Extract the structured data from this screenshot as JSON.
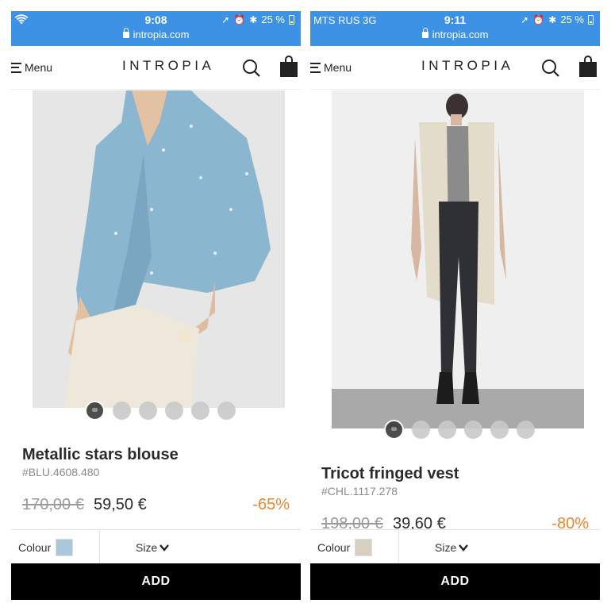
{
  "screens": [
    {
      "status": {
        "carrier": "",
        "time": "9:08",
        "url": "intropia.com",
        "battery": "25 %"
      },
      "header": {
        "menu_label": "Menu",
        "logo": "INTROPIA"
      },
      "product": {
        "name": "Metallic stars blouse",
        "sku": "#BLU.4608.480",
        "old_price": "170,00 €",
        "new_price": "59,50 €",
        "discount": "-65%",
        "image_count": 6,
        "active_image_index": 0,
        "swatch_color": "#a9c8da"
      },
      "options": {
        "colour_label": "Colour",
        "size_label": "Size"
      },
      "add_label": "ADD"
    },
    {
      "status": {
        "carrier": "MTS RUS   3G",
        "time": "9:11",
        "url": "intropia.com",
        "battery": "25 %"
      },
      "header": {
        "menu_label": "Menu",
        "logo": "INTROPIA"
      },
      "product": {
        "name": "Tricot fringed vest",
        "sku": "#CHL.1117.278",
        "old_price": "198,00 €",
        "new_price": "39,60 €",
        "discount": "-80%",
        "image_count": 6,
        "active_image_index": 0,
        "swatch_color": "#d8d0c2"
      },
      "options": {
        "colour_label": "Colour",
        "size_label": "Size"
      },
      "add_label": "ADD"
    }
  ],
  "colors": {
    "status_bar": "#3d92e6",
    "discount": "#e8862a",
    "add_button": "#000000"
  },
  "icons": [
    "wifi-icon",
    "lock-icon",
    "location-icon",
    "alarm-icon",
    "bluetooth-icon",
    "battery-icon",
    "menu-icon",
    "search-icon",
    "shopping-bag-icon",
    "chevron-down-icon"
  ]
}
